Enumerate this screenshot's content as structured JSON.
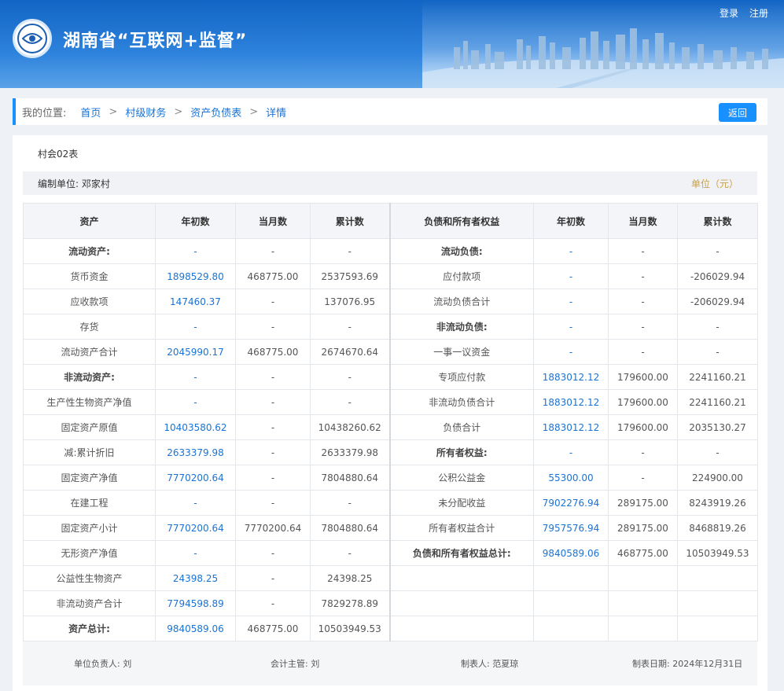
{
  "header": {
    "title": "湖南省“互联网+监督”",
    "login": "登录",
    "register": "注册"
  },
  "breadcrumb": {
    "label": "我的位置:",
    "items": [
      "首页",
      "村级财务",
      "资产负债表",
      "详情"
    ],
    "separator": ">",
    "back_button": "返回"
  },
  "report": {
    "form_no": "村会02表",
    "unit_label": "编制单位:",
    "unit_name": "邓家村",
    "currency": "单位（元）",
    "headers": [
      "资产",
      "年初数",
      "当月数",
      "累计数",
      "负债和所有者权益",
      "年初数",
      "当月数",
      "累计数"
    ],
    "rows": [
      [
        [
          "流动资产:",
          "b"
        ],
        [
          "-",
          "blue"
        ],
        [
          "-",
          ""
        ],
        [
          "-",
          ""
        ],
        [
          "流动负债:",
          "b"
        ],
        [
          "-",
          "blue"
        ],
        [
          "-",
          ""
        ],
        [
          "-",
          ""
        ]
      ],
      [
        [
          "货币资金",
          ""
        ],
        [
          "1898529.80",
          "blue"
        ],
        [
          "468775.00",
          ""
        ],
        [
          "2537593.69",
          ""
        ],
        [
          "应付款项",
          ""
        ],
        [
          "-",
          "blue"
        ],
        [
          "-",
          ""
        ],
        [
          "-206029.94",
          ""
        ]
      ],
      [
        [
          "应收款项",
          ""
        ],
        [
          "147460.37",
          "blue"
        ],
        [
          "-",
          ""
        ],
        [
          "137076.95",
          ""
        ],
        [
          "流动负债合计",
          ""
        ],
        [
          "-",
          "blue"
        ],
        [
          "-",
          ""
        ],
        [
          "-206029.94",
          ""
        ]
      ],
      [
        [
          "存货",
          ""
        ],
        [
          "-",
          "blue"
        ],
        [
          "-",
          ""
        ],
        [
          "-",
          ""
        ],
        [
          "非流动负债:",
          "b"
        ],
        [
          "-",
          "blue"
        ],
        [
          "-",
          ""
        ],
        [
          "-",
          ""
        ]
      ],
      [
        [
          "流动资产合计",
          ""
        ],
        [
          "2045990.17",
          "blue"
        ],
        [
          "468775.00",
          ""
        ],
        [
          "2674670.64",
          ""
        ],
        [
          "一事一议资金",
          ""
        ],
        [
          "-",
          "blue"
        ],
        [
          "-",
          ""
        ],
        [
          "-",
          ""
        ]
      ],
      [
        [
          "非流动资产:",
          "b"
        ],
        [
          "-",
          "blue"
        ],
        [
          "-",
          ""
        ],
        [
          "-",
          ""
        ],
        [
          "专项应付款",
          ""
        ],
        [
          "1883012.12",
          "blue"
        ],
        [
          "179600.00",
          ""
        ],
        [
          "2241160.21",
          ""
        ]
      ],
      [
        [
          "生产性生物资产净值",
          ""
        ],
        [
          "-",
          "blue"
        ],
        [
          "-",
          ""
        ],
        [
          "-",
          ""
        ],
        [
          "非流动负债合计",
          ""
        ],
        [
          "1883012.12",
          "blue"
        ],
        [
          "179600.00",
          ""
        ],
        [
          "2241160.21",
          ""
        ]
      ],
      [
        [
          "固定资产原值",
          ""
        ],
        [
          "10403580.62",
          "blue"
        ],
        [
          "-",
          ""
        ],
        [
          "10438260.62",
          ""
        ],
        [
          "负债合计",
          ""
        ],
        [
          "1883012.12",
          "blue"
        ],
        [
          "179600.00",
          ""
        ],
        [
          "2035130.27",
          ""
        ]
      ],
      [
        [
          "减:累计折旧",
          ""
        ],
        [
          "2633379.98",
          "blue"
        ],
        [
          "-",
          ""
        ],
        [
          "2633379.98",
          ""
        ],
        [
          "所有者权益:",
          "b"
        ],
        [
          "-",
          "blue"
        ],
        [
          "-",
          ""
        ],
        [
          "-",
          ""
        ]
      ],
      [
        [
          "固定资产净值",
          ""
        ],
        [
          "7770200.64",
          "blue"
        ],
        [
          "-",
          ""
        ],
        [
          "7804880.64",
          ""
        ],
        [
          "公积公益金",
          ""
        ],
        [
          "55300.00",
          "blue"
        ],
        [
          "-",
          ""
        ],
        [
          "224900.00",
          ""
        ]
      ],
      [
        [
          "在建工程",
          ""
        ],
        [
          "-",
          "blue"
        ],
        [
          "-",
          ""
        ],
        [
          "-",
          ""
        ],
        [
          "未分配收益",
          ""
        ],
        [
          "7902276.94",
          "blue"
        ],
        [
          "289175.00",
          ""
        ],
        [
          "8243919.26",
          ""
        ]
      ],
      [
        [
          "固定资产小计",
          ""
        ],
        [
          "7770200.64",
          "blue"
        ],
        [
          "7770200.64",
          ""
        ],
        [
          "7804880.64",
          ""
        ],
        [
          "所有者权益合计",
          ""
        ],
        [
          "7957576.94",
          "blue"
        ],
        [
          "289175.00",
          ""
        ],
        [
          "8468819.26",
          ""
        ]
      ],
      [
        [
          "无形资产净值",
          ""
        ],
        [
          "-",
          "blue"
        ],
        [
          "-",
          ""
        ],
        [
          "-",
          ""
        ],
        [
          "负债和所有者权益总计:",
          "b"
        ],
        [
          "9840589.06",
          "blue"
        ],
        [
          "468775.00",
          ""
        ],
        [
          "10503949.53",
          ""
        ]
      ],
      [
        [
          "公益性生物资产",
          ""
        ],
        [
          "24398.25",
          "blue"
        ],
        [
          "-",
          ""
        ],
        [
          "24398.25",
          ""
        ],
        [
          "",
          ""
        ],
        [
          "",
          ""
        ],
        [
          "",
          ""
        ],
        [
          "",
          ""
        ]
      ],
      [
        [
          "非流动资产合计",
          ""
        ],
        [
          "7794598.89",
          "blue"
        ],
        [
          "-",
          ""
        ],
        [
          "7829278.89",
          ""
        ],
        [
          "",
          ""
        ],
        [
          "",
          ""
        ],
        [
          "",
          ""
        ],
        [
          "",
          ""
        ]
      ],
      [
        [
          "资产总计:",
          "b"
        ],
        [
          "9840589.06",
          "blue"
        ],
        [
          "468775.00",
          ""
        ],
        [
          "10503949.53",
          ""
        ],
        [
          "",
          ""
        ],
        [
          "",
          ""
        ],
        [
          "",
          ""
        ],
        [
          "",
          ""
        ]
      ]
    ],
    "footer": {
      "head": "单位负责人:  刘",
      "accountant": "会计主管:  刘",
      "preparer": "制表人:  范夏琼",
      "date": "制表日期:  2024年12月31日"
    }
  },
  "colors": {
    "accent": "#1890ff",
    "link": "#1a73d4",
    "unit": "#c9a14a"
  },
  "icons": [
    "eye-emblem-icon"
  ]
}
